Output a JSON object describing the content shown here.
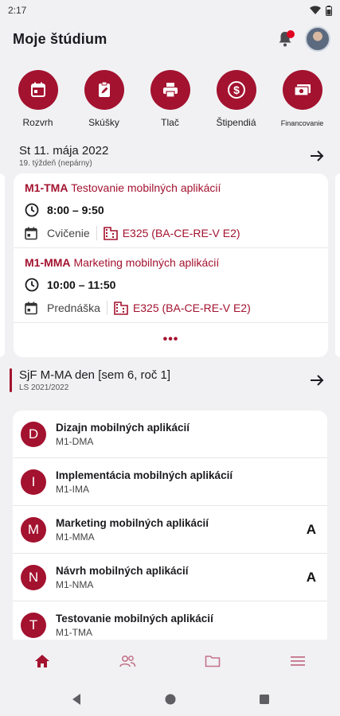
{
  "status": {
    "time": "2:17"
  },
  "app": {
    "title": "Moje štúdium"
  },
  "quick_actions": [
    {
      "label": "Rozvrh",
      "icon": "calendar-icon"
    },
    {
      "label": "Skúšky",
      "icon": "clipboard-edit-icon"
    },
    {
      "label": "Tlač",
      "icon": "printer-icon"
    },
    {
      "label": "Štipendiá",
      "icon": "dollar-icon"
    },
    {
      "label": "Financovanie",
      "icon": "money-icon"
    }
  ],
  "day": {
    "title": "St 11. mája 2022",
    "subtitle": "19. týždeň (nepárny)"
  },
  "lessons": [
    {
      "code": "M1-TMA",
      "name": "Testovanie mobilných aplikácií",
      "time": "8:00 – 9:50",
      "type": "Cvičenie",
      "room": "E325 (BA-CE-RE-V E2)"
    },
    {
      "code": "M1-MMA",
      "name": "Marketing mobilných aplikácií",
      "time": "10:00 – 11:50",
      "type": "Prednáška",
      "room": "E325 (BA-CE-RE-V E2)"
    }
  ],
  "more_label": "•••",
  "study": {
    "title": "SjF M-MA den [sem 6, roč 1]",
    "subtitle": "LS 2021/2022"
  },
  "subjects": [
    {
      "letter": "D",
      "name": "Dizajn mobilných aplikácií",
      "code": "M1-DMA",
      "grade": ""
    },
    {
      "letter": "I",
      "name": "Implementácia mobilných aplikácií",
      "code": "M1-IMA",
      "grade": ""
    },
    {
      "letter": "M",
      "name": "Marketing mobilných aplikácií",
      "code": "M1-MMA",
      "grade": "A"
    },
    {
      "letter": "N",
      "name": "Návrh mobilných aplikácií",
      "code": "M1-NMA",
      "grade": "A"
    },
    {
      "letter": "T",
      "name": "Testovanie mobilných aplikácií",
      "code": "M1-TMA",
      "grade": ""
    }
  ],
  "colors": {
    "accent": "#a3122f",
    "background": "#f1f1f3",
    "card": "#ffffff",
    "notification": "#e0001f"
  }
}
